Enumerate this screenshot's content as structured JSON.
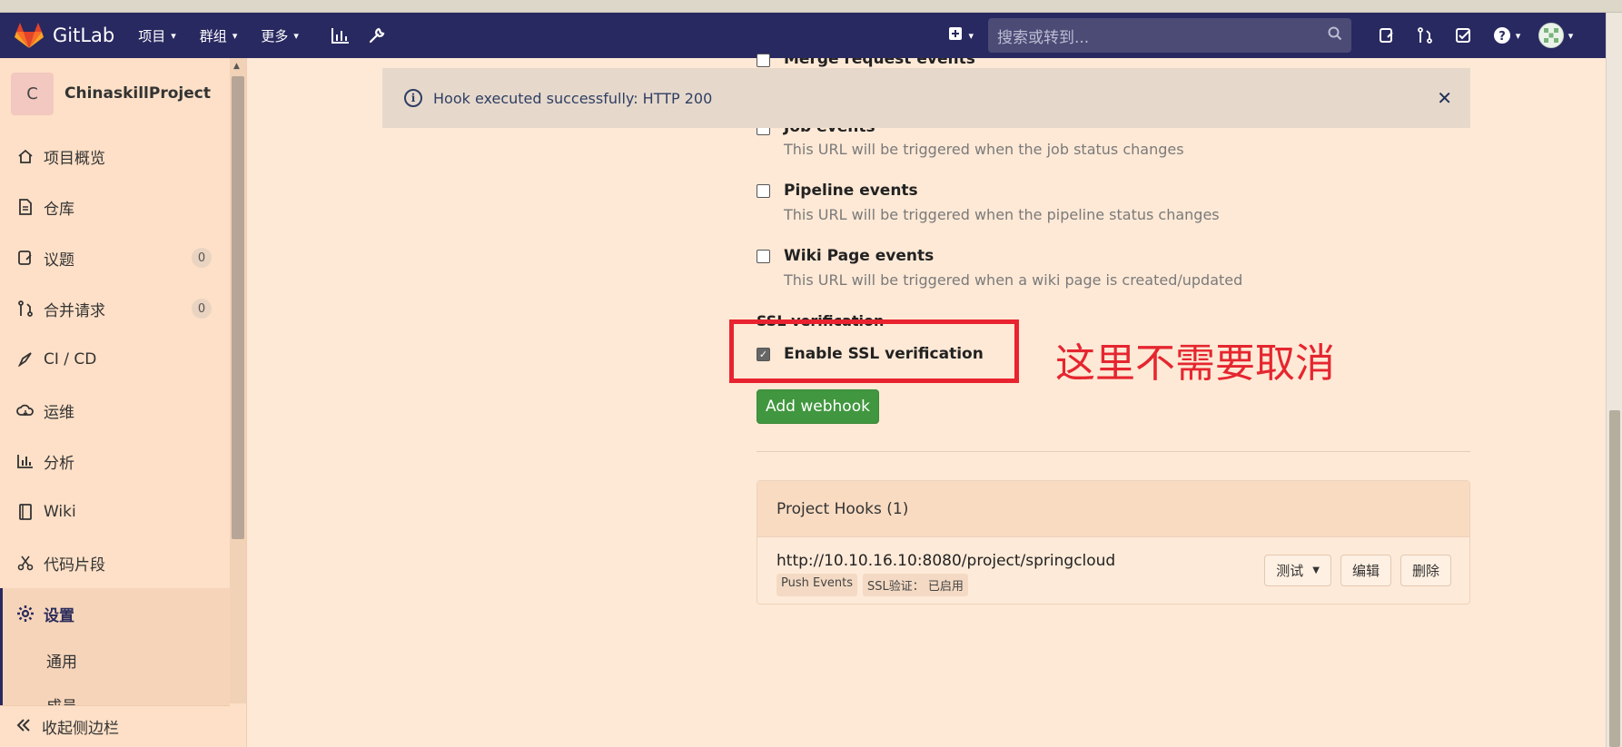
{
  "app": {
    "name": "GitLab"
  },
  "nav": {
    "menu": [
      {
        "label": "项目"
      },
      {
        "label": "群组"
      },
      {
        "label": "更多"
      }
    ],
    "search_placeholder": "搜索或转到..."
  },
  "sidebar": {
    "project_initial": "C",
    "project_name": "ChinaskillProject",
    "items": [
      {
        "label": "项目概览",
        "icon": "home-icon"
      },
      {
        "label": "仓库",
        "icon": "document-icon"
      },
      {
        "label": "议题",
        "icon": "issues-icon",
        "badge": "0"
      },
      {
        "label": "合并请求",
        "icon": "merge-request-icon",
        "badge": "0"
      },
      {
        "label": "CI / CD",
        "icon": "rocket-icon"
      },
      {
        "label": "运维",
        "icon": "cloud-icon"
      },
      {
        "label": "分析",
        "icon": "chart-icon"
      },
      {
        "label": "Wiki",
        "icon": "book-icon"
      },
      {
        "label": "代码片段",
        "icon": "scissors-icon"
      },
      {
        "label": "设置",
        "icon": "gear-icon",
        "active": true
      }
    ],
    "subitems": [
      {
        "label": "通用"
      },
      {
        "label": "成员"
      }
    ],
    "collapse_label": "收起侧边栏"
  },
  "flash": {
    "message": "Hook executed successfully: HTTP 200"
  },
  "events": {
    "merge_request": "Merge request events",
    "job_title": "Job events",
    "job_desc": "This URL will be triggered when the job status changes",
    "pipeline_title": "Pipeline events",
    "pipeline_desc": "This URL will be triggered when the pipeline status changes",
    "wiki_title": "Wiki Page events",
    "wiki_desc": "This URL will be triggered when a wiki page is created/updated"
  },
  "ssl": {
    "section_label": "SSL verification",
    "checkbox_label": "Enable SSL verification",
    "checked": true
  },
  "annotation": {
    "text": "这里不需要取消",
    "color": "#e5262f"
  },
  "add_webhook_label": "Add webhook",
  "hooks": {
    "title": "Project Hooks (1)",
    "list": [
      {
        "url": "http://10.10.16.10:8080/project/springcloud",
        "tags": [
          "Push Events",
          "SSL验证：  已启用"
        ],
        "test_label": "测试",
        "edit_label": "编辑",
        "delete_label": "删除"
      }
    ]
  },
  "colors": {
    "navbar": "#292961",
    "accent_green": "#41973f",
    "background": "#fee9d6"
  }
}
